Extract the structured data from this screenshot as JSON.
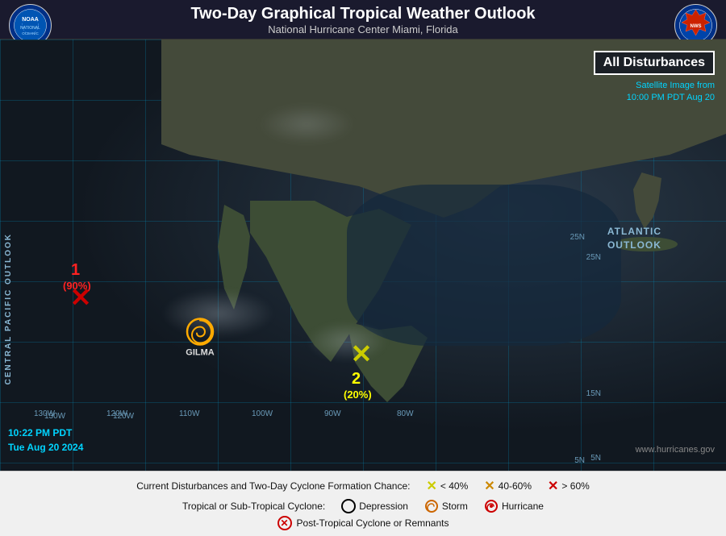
{
  "header": {
    "title": "Two-Day Graphical Tropical Weather Outlook",
    "subtitle": "National Hurricane Center  Miami, Florida"
  },
  "disturbances_box": "All Disturbances",
  "satellite_info": {
    "line1": "Satellite Image from",
    "line2": "10:00 PM PDT Aug 20"
  },
  "timestamp": {
    "line1": "10:22 PM PDT",
    "line2": "Tue Aug 20 2024"
  },
  "watermark": "www.hurricanes.gov",
  "map_labels": {
    "atlantic_outlook": "ATLANTIC\nOUTLOOK",
    "central_pacific": "CENTRAL PACIFIC OUTLOOK"
  },
  "markers": {
    "disturbance1": {
      "number": "1",
      "probability": "(90%)",
      "color": "red"
    },
    "disturbance2": {
      "number": "2",
      "probability": "(20%)",
      "color": "yellow"
    },
    "gilma": {
      "name": "GILMA",
      "type": "storm"
    }
  },
  "legend": {
    "line1": "Current Disturbances and Two-Day Cyclone Formation Chance:",
    "items1": [
      {
        "symbol": "✕",
        "color": "#cccc00",
        "text": "< 40%"
      },
      {
        "symbol": "✕",
        "color": "#cc8800",
        "text": "40-60%"
      },
      {
        "symbol": "✕",
        "color": "#cc0000",
        "text": "> 60%"
      }
    ],
    "line2_label": "Tropical or Sub-Tropical Cyclone:",
    "items2": [
      {
        "symbol": "○",
        "color": "#000",
        "text": "Depression"
      },
      {
        "symbol": "⚇",
        "color": "#000",
        "text": "Storm"
      },
      {
        "symbol": "⚆",
        "color": "#cc0000",
        "text": "Hurricane"
      }
    ],
    "line3": {
      "symbol": "⊗",
      "color": "#cc0000",
      "text": "Post-Tropical Cyclone or Remnants"
    }
  },
  "coord_labels": {
    "lat_5n": "5N",
    "lat_15n": "15N",
    "lat_25n": "25N",
    "lon_80w": "80W",
    "lon_90w": "90W",
    "lon_100w": "100W",
    "lon_110w": "110W",
    "lon_120w": "120W",
    "lon_130w": "130W"
  }
}
